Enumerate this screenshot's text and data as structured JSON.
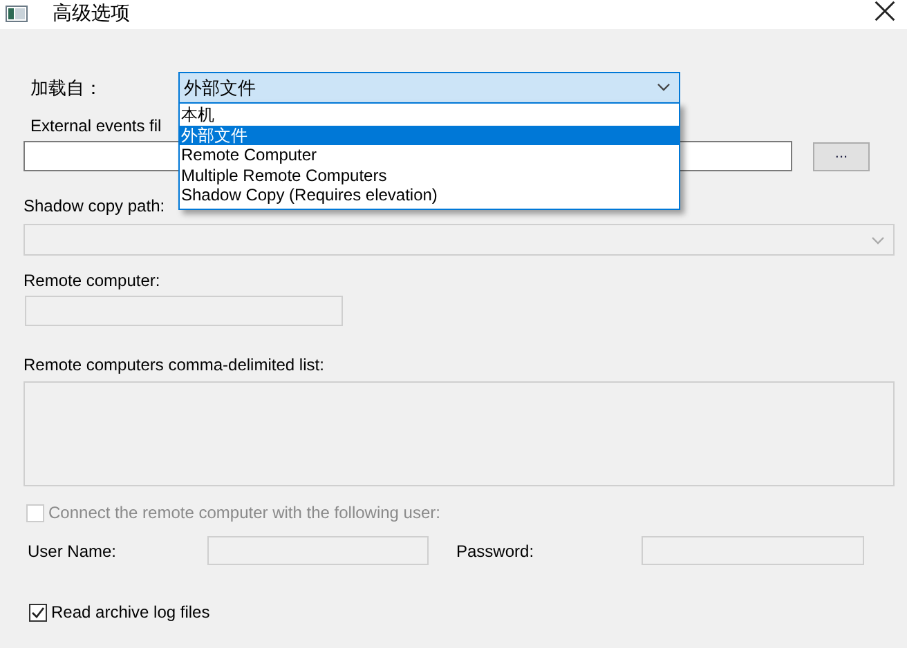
{
  "window": {
    "title": "高级选项"
  },
  "load_from": {
    "label": "加载自：",
    "value": "外部文件",
    "expanded": true,
    "options": [
      {
        "label": "本机",
        "selected": false
      },
      {
        "label": "外部文件",
        "selected": true
      },
      {
        "label": "Remote Computer",
        "selected": false
      },
      {
        "label": "Multiple Remote Computers",
        "selected": false
      },
      {
        "label": "Shadow Copy (Requires elevation)",
        "selected": false
      }
    ]
  },
  "external_file": {
    "label": "External events fil",
    "disabled": false
  },
  "browse_button": {
    "label": "..."
  },
  "shadow_copy": {
    "label": "Shadow copy path:",
    "disabled": true
  },
  "remote_computer": {
    "label": "Remote computer:",
    "disabled": true
  },
  "remote_list": {
    "label": "Remote computers comma-delimited list:",
    "disabled": true
  },
  "connect_as_user": {
    "label": "Connect the remote computer with the following user:",
    "checked": false,
    "disabled": true
  },
  "user_name": {
    "label": "User Name:",
    "disabled": true
  },
  "password": {
    "label": "Password:",
    "disabled": true
  },
  "read_archive": {
    "label": "Read archive log files",
    "checked": true,
    "disabled": false
  }
}
